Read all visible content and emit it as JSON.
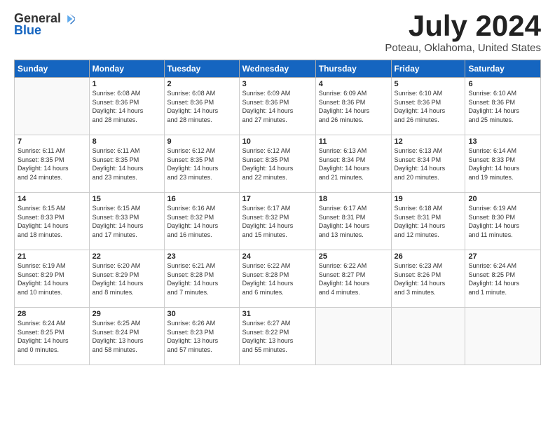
{
  "logo": {
    "general": "General",
    "blue": "Blue"
  },
  "title": "July 2024",
  "location": "Poteau, Oklahoma, United States",
  "days_header": [
    "Sunday",
    "Monday",
    "Tuesday",
    "Wednesday",
    "Thursday",
    "Friday",
    "Saturday"
  ],
  "weeks": [
    [
      {
        "day": "",
        "info": ""
      },
      {
        "day": "1",
        "info": "Sunrise: 6:08 AM\nSunset: 8:36 PM\nDaylight: 14 hours\nand 28 minutes."
      },
      {
        "day": "2",
        "info": "Sunrise: 6:08 AM\nSunset: 8:36 PM\nDaylight: 14 hours\nand 28 minutes."
      },
      {
        "day": "3",
        "info": "Sunrise: 6:09 AM\nSunset: 8:36 PM\nDaylight: 14 hours\nand 27 minutes."
      },
      {
        "day": "4",
        "info": "Sunrise: 6:09 AM\nSunset: 8:36 PM\nDaylight: 14 hours\nand 26 minutes."
      },
      {
        "day": "5",
        "info": "Sunrise: 6:10 AM\nSunset: 8:36 PM\nDaylight: 14 hours\nand 26 minutes."
      },
      {
        "day": "6",
        "info": "Sunrise: 6:10 AM\nSunset: 8:36 PM\nDaylight: 14 hours\nand 25 minutes."
      }
    ],
    [
      {
        "day": "7",
        "info": ""
      },
      {
        "day": "8",
        "info": "Sunrise: 6:11 AM\nSunset: 8:35 PM\nDaylight: 14 hours\nand 23 minutes."
      },
      {
        "day": "9",
        "info": "Sunrise: 6:12 AM\nSunset: 8:35 PM\nDaylight: 14 hours\nand 23 minutes."
      },
      {
        "day": "10",
        "info": "Sunrise: 6:12 AM\nSunset: 8:35 PM\nDaylight: 14 hours\nand 22 minutes."
      },
      {
        "day": "11",
        "info": "Sunrise: 6:13 AM\nSunset: 8:34 PM\nDaylight: 14 hours\nand 21 minutes."
      },
      {
        "day": "12",
        "info": "Sunrise: 6:13 AM\nSunset: 8:34 PM\nDaylight: 14 hours\nand 20 minutes."
      },
      {
        "day": "13",
        "info": "Sunrise: 6:14 AM\nSunset: 8:33 PM\nDaylight: 14 hours\nand 19 minutes."
      }
    ],
    [
      {
        "day": "14",
        "info": ""
      },
      {
        "day": "15",
        "info": "Sunrise: 6:15 AM\nSunset: 8:33 PM\nDaylight: 14 hours\nand 17 minutes."
      },
      {
        "day": "16",
        "info": "Sunrise: 6:16 AM\nSunset: 8:32 PM\nDaylight: 14 hours\nand 16 minutes."
      },
      {
        "day": "17",
        "info": "Sunrise: 6:17 AM\nSunset: 8:32 PM\nDaylight: 14 hours\nand 15 minutes."
      },
      {
        "day": "18",
        "info": "Sunrise: 6:17 AM\nSunset: 8:31 PM\nDaylight: 14 hours\nand 13 minutes."
      },
      {
        "day": "19",
        "info": "Sunrise: 6:18 AM\nSunset: 8:31 PM\nDaylight: 14 hours\nand 12 minutes."
      },
      {
        "day": "20",
        "info": "Sunrise: 6:19 AM\nSunset: 8:30 PM\nDaylight: 14 hours\nand 11 minutes."
      }
    ],
    [
      {
        "day": "21",
        "info": ""
      },
      {
        "day": "22",
        "info": "Sunrise: 6:20 AM\nSunset: 8:29 PM\nDaylight: 14 hours\nand 8 minutes."
      },
      {
        "day": "23",
        "info": "Sunrise: 6:21 AM\nSunset: 8:28 PM\nDaylight: 14 hours\nand 7 minutes."
      },
      {
        "day": "24",
        "info": "Sunrise: 6:22 AM\nSunset: 8:28 PM\nDaylight: 14 hours\nand 6 minutes."
      },
      {
        "day": "25",
        "info": "Sunrise: 6:22 AM\nSunset: 8:27 PM\nDaylight: 14 hours\nand 4 minutes."
      },
      {
        "day": "26",
        "info": "Sunrise: 6:23 AM\nSunset: 8:26 PM\nDaylight: 14 hours\nand 3 minutes."
      },
      {
        "day": "27",
        "info": "Sunrise: 6:24 AM\nSunset: 8:25 PM\nDaylight: 14 hours\nand 1 minute."
      }
    ],
    [
      {
        "day": "28",
        "info": "Sunrise: 6:24 AM\nSunset: 8:25 PM\nDaylight: 14 hours\nand 0 minutes."
      },
      {
        "day": "29",
        "info": "Sunrise: 6:25 AM\nSunset: 8:24 PM\nDaylight: 13 hours\nand 58 minutes."
      },
      {
        "day": "30",
        "info": "Sunrise: 6:26 AM\nSunset: 8:23 PM\nDaylight: 13 hours\nand 57 minutes."
      },
      {
        "day": "31",
        "info": "Sunrise: 6:27 AM\nSunset: 8:22 PM\nDaylight: 13 hours\nand 55 minutes."
      },
      {
        "day": "",
        "info": ""
      },
      {
        "day": "",
        "info": ""
      },
      {
        "day": "",
        "info": ""
      }
    ]
  ],
  "week1_sun_info": "Sunrise: 6:11 AM\nSunset: 8:35 PM\nDaylight: 14 hours\nand 24 minutes.",
  "week3_sun_info": "Sunrise: 6:15 AM\nSunset: 8:33 PM\nDaylight: 14 hours\nand 18 minutes.",
  "week4_sun_info": "Sunrise: 6:19 AM\nSunset: 8:29 PM\nDaylight: 14 hours\nand 10 minutes."
}
